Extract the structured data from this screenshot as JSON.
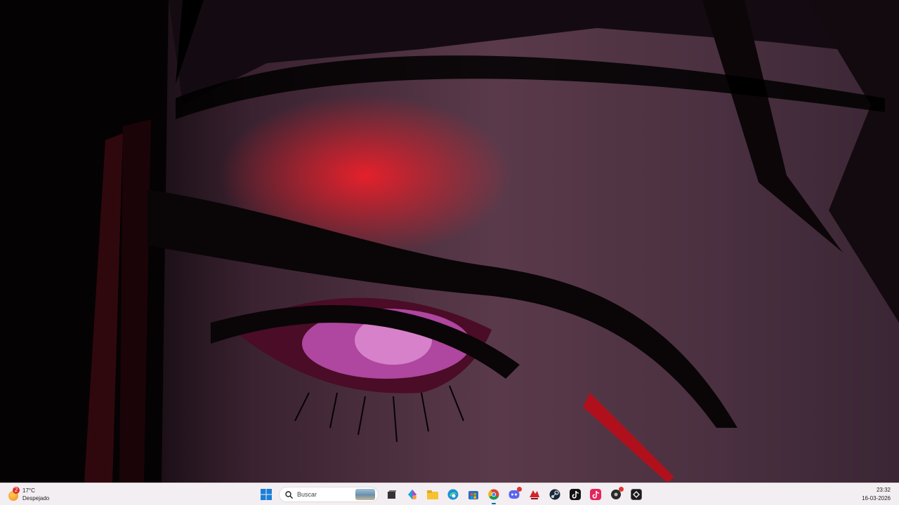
{
  "weather": {
    "temperature": "17°C",
    "condition": "Despejado",
    "badge_count": "2"
  },
  "search": {
    "placeholder": "Buscar"
  },
  "taskbar_apps": [
    "windows-start-icon",
    "search-icon",
    "task-view-icon",
    "copilot-icon",
    "file-explorer-icon",
    "edge-icon",
    "store-icon",
    "chrome-icon",
    "discord-icon",
    "app-red-icon",
    "steam-icon",
    "tiktok-icon",
    "tiktok-pink-icon",
    "media-player-icon",
    "app-dark-icon"
  ],
  "clock": {
    "time": "23:32",
    "date": "16-03-2026"
  },
  "colors": {
    "taskbar_bg": "#f3eef1",
    "accent": "#0067c0",
    "wallpaper_red": "#ff1e28"
  }
}
